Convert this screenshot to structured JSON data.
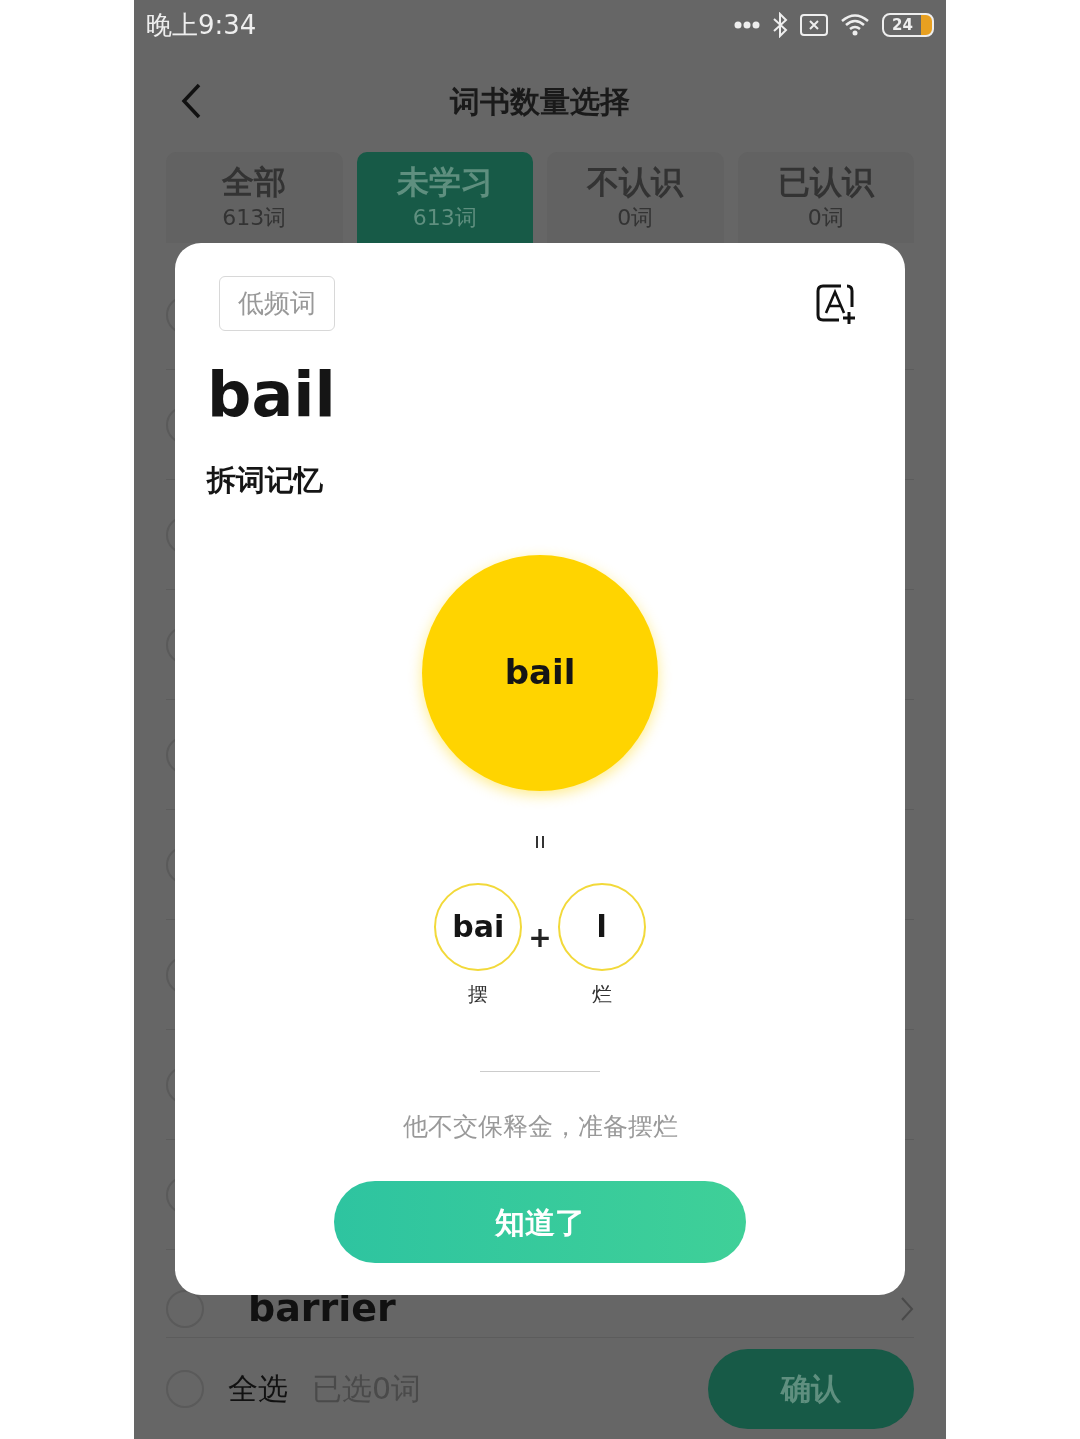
{
  "status_bar": {
    "time": "晚上9:34",
    "battery": "24"
  },
  "header": {
    "title": "词书数量选择"
  },
  "tabs": [
    {
      "label": "全部",
      "count": "613词",
      "selected": false
    },
    {
      "label": "未学习",
      "count": "613词",
      "selected": true
    },
    {
      "label": "不认识",
      "count": "0词",
      "selected": false
    },
    {
      "label": "已认识",
      "count": "0词",
      "selected": false
    }
  ],
  "rows": [
    {
      "checked": false
    },
    {
      "checked": false
    },
    {
      "checked": false
    },
    {
      "checked": false
    },
    {
      "checked": false
    },
    {
      "checked": false
    },
    {
      "checked": false
    },
    {
      "checked": false
    },
    {
      "checked": false
    },
    {
      "word": "barrier",
      "checked": false
    }
  ],
  "bottom_bar": {
    "select_all": "全选",
    "select_all_checked": false,
    "selected_count": "已选0词",
    "confirm": "确认"
  },
  "dialog": {
    "tag": "低频词",
    "word": "bail",
    "section": "拆词记忆",
    "root": "bail",
    "parts": [
      {
        "text": "bai",
        "meaning": "摆"
      },
      {
        "text": "l",
        "meaning": "烂"
      }
    ],
    "plus": "+",
    "sentence": "他不交保释金，准备摆烂",
    "button": "知道了"
  }
}
